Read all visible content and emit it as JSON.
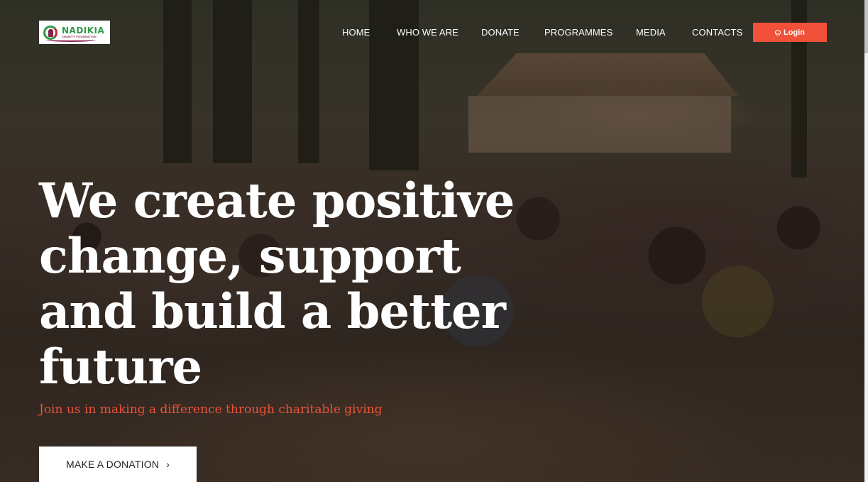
{
  "brand": {
    "logo_name": "NADIKIA",
    "logo_sub": "CHARITY FOUNDATION"
  },
  "nav": {
    "items": [
      {
        "label": "HOME"
      },
      {
        "label": "WHO WE ARE"
      },
      {
        "label": "DONATE"
      },
      {
        "label": "PROGRAMMES"
      },
      {
        "label": "MEDIA"
      },
      {
        "label": "CONTACTS"
      }
    ],
    "login_label": "Login",
    "login_icon": "user-circle-icon"
  },
  "hero": {
    "headline": "We create positive change, support and build a better future",
    "subline": "Join us in making a difference through charitable giving",
    "cta_label": "MAKE A DONATION",
    "cta_icon": "chevron-right-icon"
  },
  "colors": {
    "accent": "#f05138",
    "text_light": "#ffffff",
    "button_bg": "#ffffff"
  }
}
